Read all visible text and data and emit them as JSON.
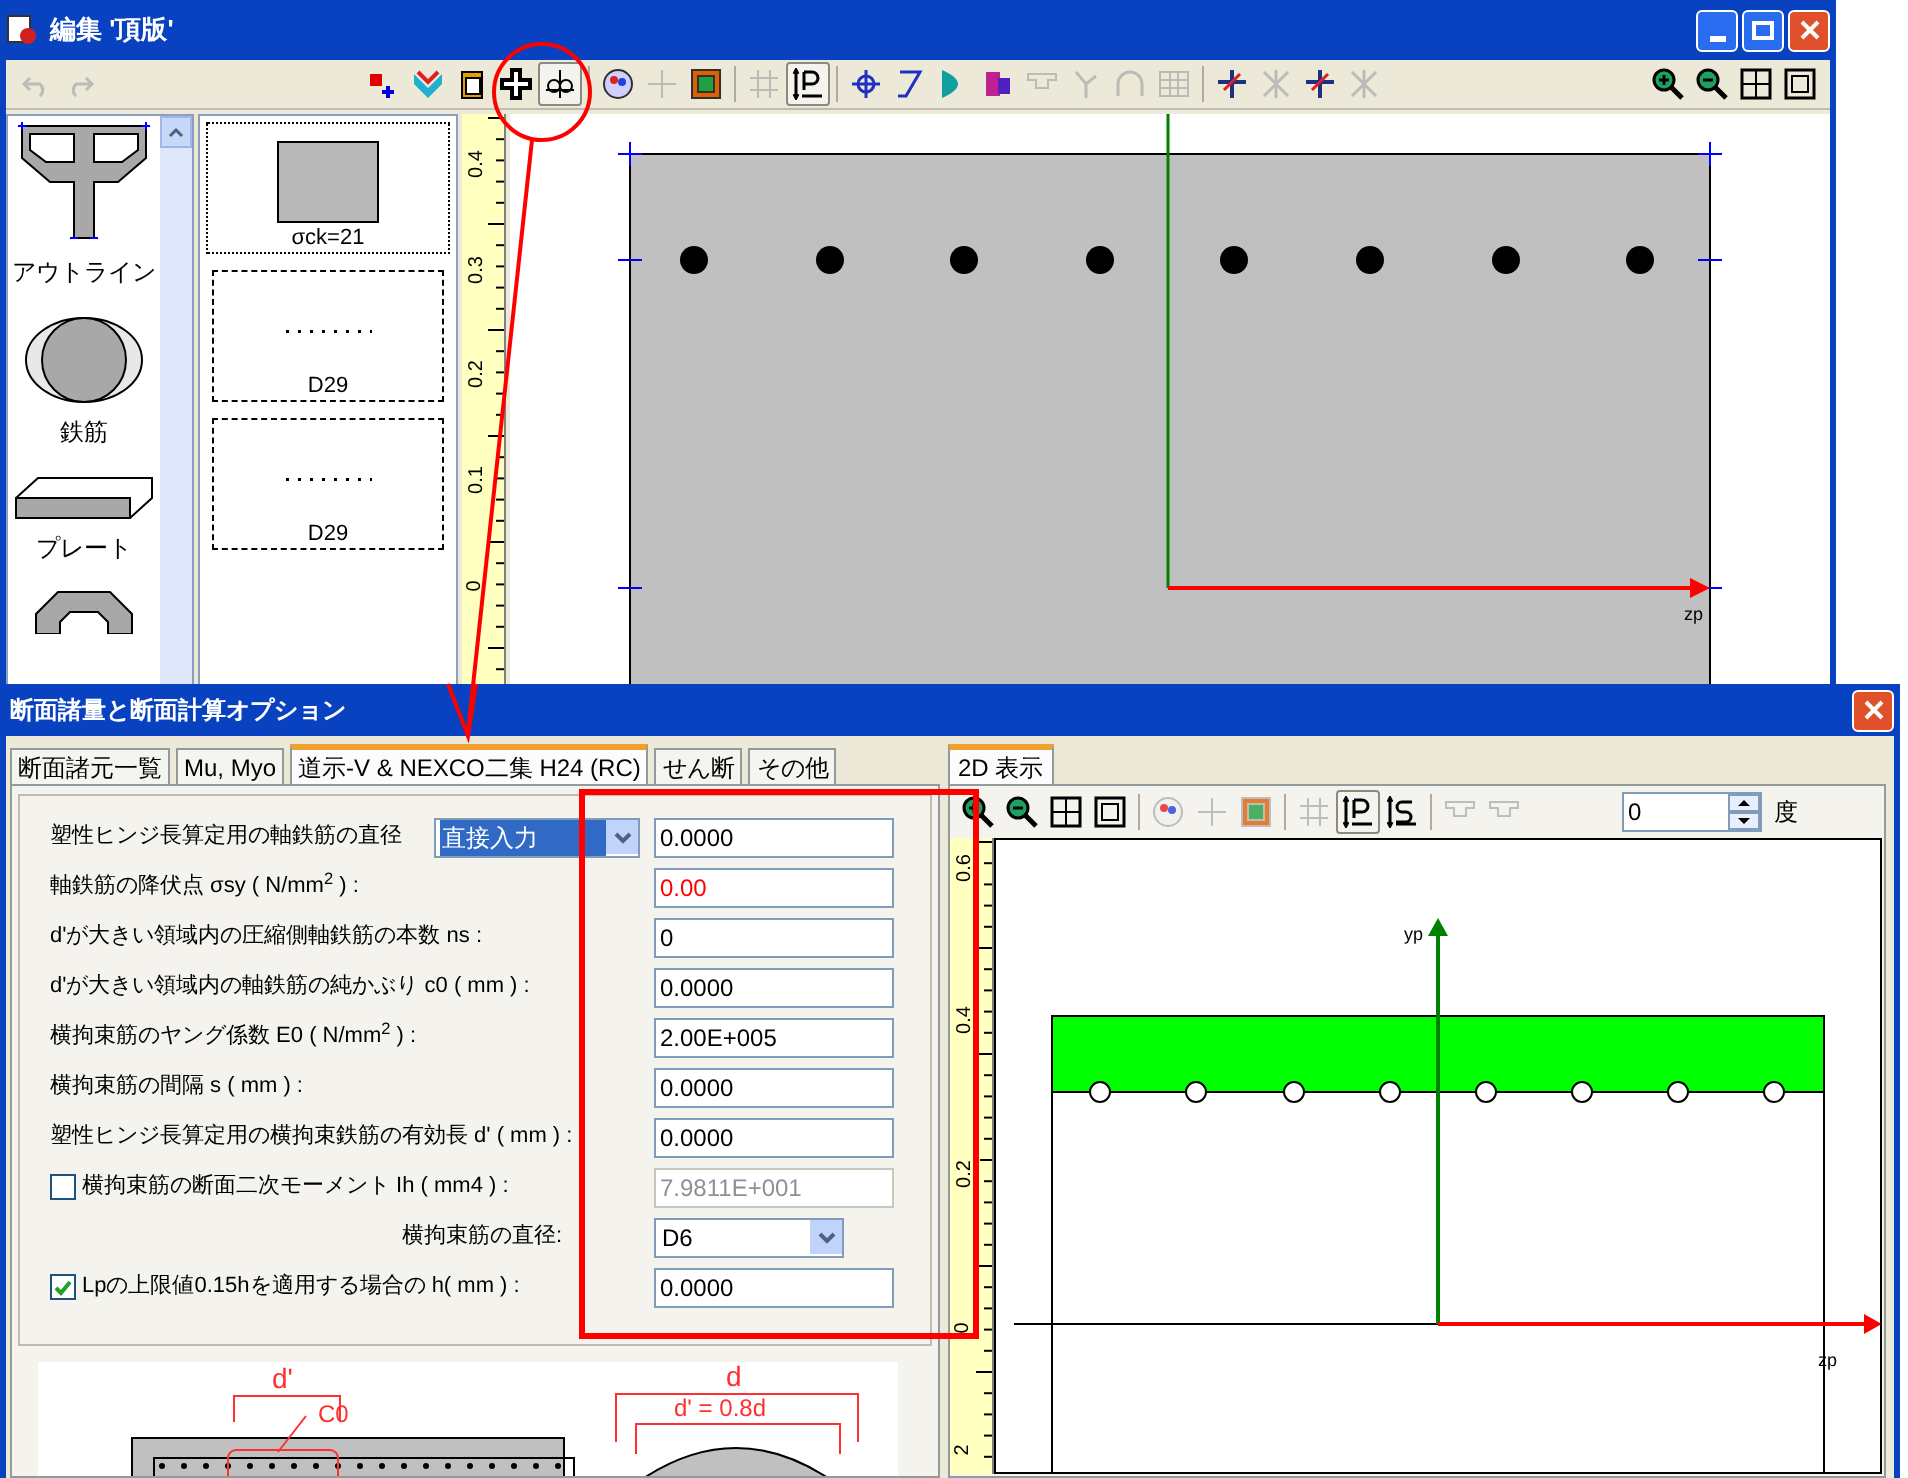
{
  "main_window": {
    "title": "編集 '頂版'",
    "toolbar": [
      {
        "kind": "undo",
        "pressed": false,
        "disabled": true
      },
      {
        "kind": "redo",
        "pressed": false,
        "disabled": true
      },
      {
        "kind": "gap"
      },
      {
        "kind": "add-point",
        "pressed": false,
        "disabled": false
      },
      {
        "kind": "chevron",
        "pressed": false,
        "disabled": false
      },
      {
        "kind": "clipboard",
        "pressed": false,
        "disabled": false
      },
      {
        "kind": "cross",
        "pressed": false,
        "disabled": false
      },
      {
        "kind": "centroid",
        "pressed": true,
        "disabled": false
      },
      {
        "kind": "sep"
      },
      {
        "kind": "palette",
        "pressed": false,
        "disabled": false
      },
      {
        "kind": "move",
        "pressed": false,
        "disabled": true
      },
      {
        "kind": "frame",
        "pressed": false,
        "disabled": false
      },
      {
        "kind": "sep"
      },
      {
        "kind": "grid",
        "pressed": false,
        "disabled": true
      },
      {
        "kind": "ip",
        "pressed": true,
        "disabled": false
      },
      {
        "kind": "sep"
      },
      {
        "kind": "axis",
        "pressed": false,
        "disabled": false
      },
      {
        "kind": "slope",
        "pressed": false,
        "disabled": false
      },
      {
        "kind": "half",
        "pressed": false,
        "disabled": false
      },
      {
        "kind": "mirror",
        "pressed": false,
        "disabled": false
      },
      {
        "kind": "stub",
        "pressed": false,
        "disabled": true
      },
      {
        "kind": "hook",
        "pressed": false,
        "disabled": true
      },
      {
        "kind": "arch",
        "pressed": false,
        "disabled": true
      },
      {
        "kind": "table",
        "pressed": false,
        "disabled": true
      },
      {
        "kind": "sep"
      },
      {
        "kind": "pin",
        "pressed": false,
        "disabled": false
      },
      {
        "kind": "x",
        "pressed": false,
        "disabled": true
      },
      {
        "kind": "pin",
        "pressed": false,
        "disabled": false
      },
      {
        "kind": "x",
        "pressed": false,
        "disabled": true
      },
      {
        "kind": "gap"
      },
      {
        "kind": "zoom-in",
        "pressed": false,
        "disabled": false
      },
      {
        "kind": "zoom-out",
        "pressed": false,
        "disabled": false
      },
      {
        "kind": "fit",
        "pressed": false,
        "disabled": false
      },
      {
        "kind": "window",
        "pressed": false,
        "disabled": false
      }
    ],
    "palette": [
      {
        "kind": "outline",
        "label": "アウトライン"
      },
      {
        "kind": "rebar",
        "label": "鉄筋"
      },
      {
        "kind": "plate",
        "label": "プレート"
      },
      {
        "kind": "ring"
      }
    ],
    "layers": [
      {
        "kind": "concrete",
        "label": "σck=21",
        "selected": true
      },
      {
        "kind": "rebar-row",
        "label": "D29",
        "selected": false
      },
      {
        "kind": "rebar-row",
        "label": "D29",
        "selected": false
      }
    ],
    "ruler_labels": [
      "0.4",
      "0.3",
      "0.2",
      "0.1",
      "0"
    ],
    "axis_label": "zp"
  },
  "dialog": {
    "title": "断面諸量と断面計算オプション",
    "tabs": [
      {
        "label": "断面諸元一覧",
        "selected": false
      },
      {
        "label": "Mu, Myo",
        "selected": false
      },
      {
        "label": "道示-V & NEXCO二集 H24 (RC)",
        "selected": true
      },
      {
        "label": "せん断",
        "selected": false
      },
      {
        "label": "その他",
        "selected": false
      }
    ],
    "form": [
      {
        "kind": "select-field",
        "label": "塑性ヒンジ長算定用の軸鉄筋の直径",
        "select": "直接入力",
        "value": "0.0000",
        "disabled": false,
        "error": false
      },
      {
        "kind": "field",
        "label": "軸鉄筋の降伏点 σsy ( N/mm$^{2}$ ) :",
        "value": "0.00",
        "disabled": false,
        "error": true
      },
      {
        "kind": "field",
        "label": "d'が大きい領域内の圧縮側軸鉄筋の本数 ns :",
        "value": "0",
        "disabled": false,
        "error": false
      },
      {
        "kind": "field",
        "label": "d'が大きい領域内の軸鉄筋の純かぶり c0 ( mm ) :",
        "value": "0.0000",
        "disabled": false,
        "error": false
      },
      {
        "kind": "field",
        "label": "横拘束筋のヤング係数 E0 ( N/mm$^{2}$ ) :",
        "value": "2.00E+005",
        "disabled": false,
        "error": false
      },
      {
        "kind": "field",
        "label": "横拘束筋の間隔 s ( mm ) :",
        "value": "0.0000",
        "disabled": false,
        "error": false
      },
      {
        "kind": "field",
        "label": "塑性ヒンジ長算定用の横拘束鉄筋の有効長 d' ( mm ) :",
        "value": "0.0000",
        "disabled": false,
        "error": false
      },
      {
        "kind": "check-field",
        "label": "横拘束筋の断面二次モーメント Ih ( mm4 ) :",
        "checked": false,
        "value": "7.9811E+001",
        "disabled": true,
        "error": false
      },
      {
        "kind": "select",
        "label": "横拘束筋の直径:",
        "select": "D6"
      },
      {
        "kind": "check-field",
        "label": "Lpの上限値0.15hを適用する場合の h( mm ) :",
        "checked": true,
        "value": "0.0000",
        "disabled": false,
        "error": false
      }
    ],
    "diagram_labels": [
      "d'",
      "C0",
      "d",
      "d' = 0.8d"
    ],
    "view": {
      "tab": {
        "label": "2D 表示",
        "selected": true
      },
      "toolbar": [
        {
          "kind": "zoom-in",
          "pressed": false,
          "disabled": false
        },
        {
          "kind": "zoom-out",
          "pressed": false,
          "disabled": false
        },
        {
          "kind": "fit",
          "pressed": false,
          "disabled": false
        },
        {
          "kind": "window",
          "pressed": false,
          "disabled": false
        },
        {
          "kind": "sep"
        },
        {
          "kind": "palette",
          "pressed": false,
          "disabled": true
        },
        {
          "kind": "move",
          "pressed": false,
          "disabled": true
        },
        {
          "kind": "frame",
          "pressed": false,
          "disabled": true
        },
        {
          "kind": "sep"
        },
        {
          "kind": "grid",
          "pressed": false,
          "disabled": true
        },
        {
          "kind": "ip",
          "pressed": true,
          "disabled": false
        },
        {
          "kind": "is",
          "pressed": false,
          "disabled": false
        },
        {
          "kind": "sep"
        },
        {
          "kind": "stub",
          "pressed": false,
          "disabled": true
        },
        {
          "kind": "stub",
          "pressed": false,
          "disabled": true
        }
      ],
      "angle": {
        "value": "0",
        "unit": "度"
      },
      "ruler_labels": [
        "0.6",
        "0.4",
        "0.2",
        "0",
        "2"
      ],
      "axis_labels": [
        "yp",
        "zp"
      ]
    }
  }
}
